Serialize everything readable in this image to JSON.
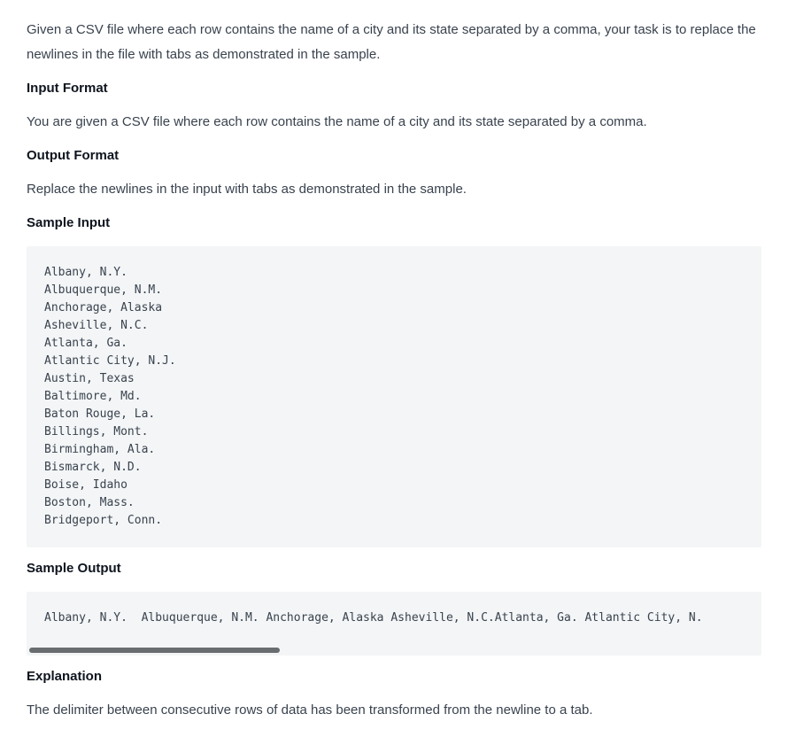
{
  "intro": "Given a CSV file where each row contains the name of a city and its state separated by a comma, your task is to replace the newlines in the file with tabs as demonstrated in the sample.",
  "input_format": {
    "heading": "Input Format",
    "text": "You are given a CSV file where each row contains the name of a city and its state separated by a comma."
  },
  "output_format": {
    "heading": "Output Format",
    "text": "Replace the newlines in the input with tabs as demonstrated in the sample."
  },
  "sample_input": {
    "heading": "Sample Input",
    "code": "Albany, N.Y.\nAlbuquerque, N.M.\nAnchorage, Alaska\nAsheville, N.C.\nAtlanta, Ga.\nAtlantic City, N.J.\nAustin, Texas\nBaltimore, Md.\nBaton Rouge, La.\nBillings, Mont.\nBirmingham, Ala.\nBismarck, N.D.\nBoise, Idaho\nBoston, Mass.\nBridgeport, Conn."
  },
  "sample_output": {
    "heading": "Sample Output",
    "code": "Albany, N.Y.\tAlbuquerque, N.M.\tAnchorage, Alaska\tAsheville, N.C.Atlanta, Ga.\tAtlantic City, N."
  },
  "explanation": {
    "heading": "Explanation",
    "text": "The delimiter between consecutive rows of data has been transformed from the newline to a tab."
  }
}
